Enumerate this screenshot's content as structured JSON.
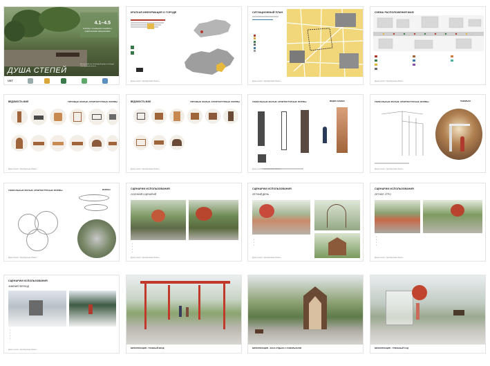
{
  "cover": {
    "number": "4.1–4.5",
    "label": "Альбом с основными схемами и графическими материалами",
    "title": "ДУША СТЕПЕЙ",
    "small": "Благоустройство пешеходной улицы и площади Оренбургской области",
    "logo_text": "UST"
  },
  "city": {
    "title": "КРАТКАЯ ИНФОРМАЦИЯ О ГОРОДЕ"
  },
  "situation": {
    "title": "СИТУАЦИОННЫЙ ПЛАН"
  },
  "scheme": {
    "title": "СХЕМА РАСПОЛОЖЕНИЯ МАФ"
  },
  "maf_common": {
    "title": "ТИПОВЫЕ МАЛЫЕ АРХИТЕКТУРНЫЕ ФОРМЫ"
  },
  "maf_unique": {
    "title": "УНИКАЛЬНЫЕ МАЛЫЕ АРХИТЕКТУРНЫЕ ФОРМЫ",
    "sub_a": "ВЕДОМОСТЬ МАФ",
    "sub_b": "ПАВИЛЬОН",
    "sub_c": "ВАЗОНЫ",
    "sub_d": "МЕДИА-СКАМЬЯ"
  },
  "scenario": {
    "title": "СЦЕНАРИИ ИСПОЛЬЗОВАНИЯ",
    "autumn": "ОСЕННИЙ СЦЕНАРИЙ",
    "summer": "ЛЕТНИЙ ДЕНЬ",
    "spring": "ЛЕТНЕЕ УТРО",
    "winter": "ЗИМНИЙ ПЕРИОД"
  },
  "viz": {
    "main": "ВИЗУАЛИЗАЦИЯ - ГЛАВНЫЙ ВХОД",
    "arch": "ВИЗУАЛИЗАЦИЯ - ЗОНА ОТДЫХА С ПАВИЛЬОНОМ",
    "fog": "ВИЗУАЛИЗАЦИЯ - ТУМАННЫЙ САД"
  },
  "footer": "Душа степей - Оренбургская область",
  "colors": {
    "accent": "#b03a2e",
    "maf_wood": "#a0643a",
    "steel": "#4a4a4a",
    "map": "#f2d77a"
  }
}
